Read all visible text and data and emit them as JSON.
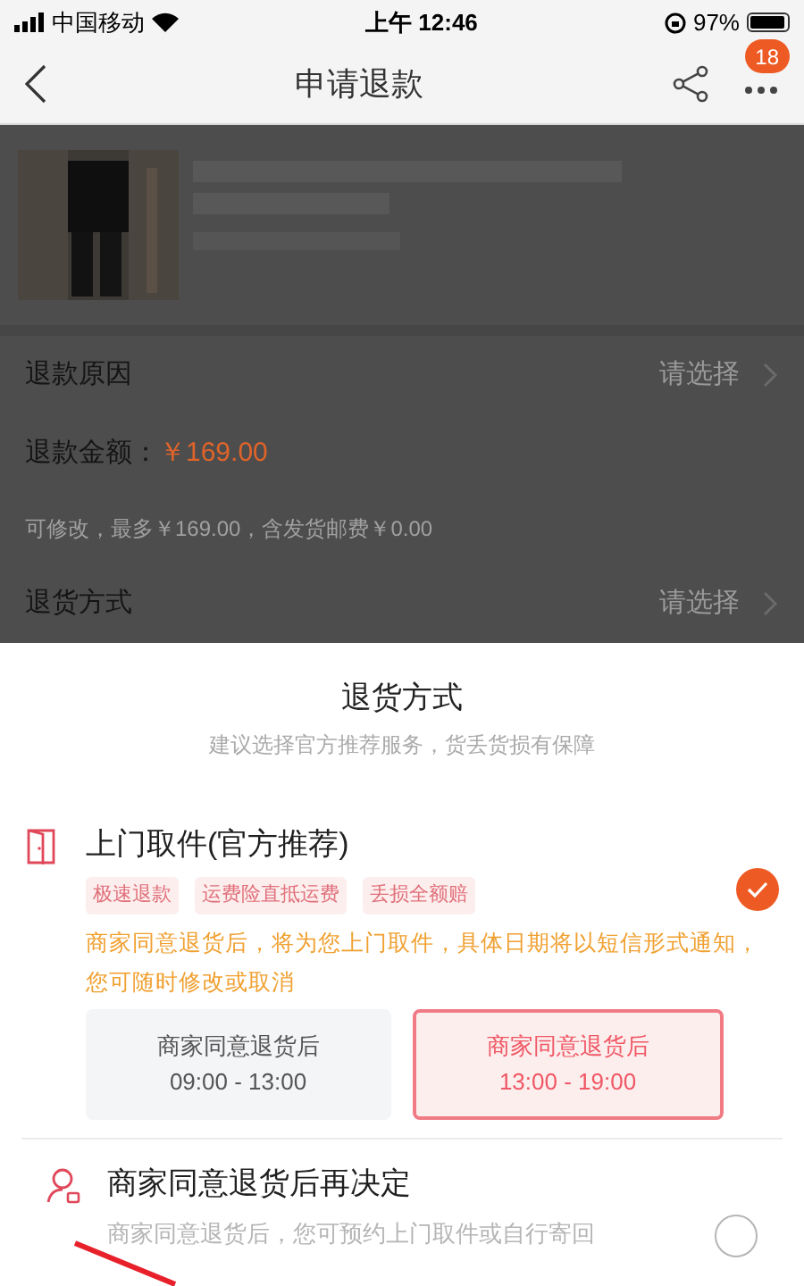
{
  "status_bar": {
    "carrier": "中国移动",
    "time": "上午 12:46",
    "battery": "97%"
  },
  "nav": {
    "title": "申请退款",
    "badge": "18"
  },
  "form": [
    {
      "kind": "select",
      "label": "退款原因",
      "value": "请选择"
    },
    {
      "kind": "amount",
      "label": "退款金额：",
      "amount": "￥169.00"
    },
    {
      "kind": "note",
      "text": "可修改，最多￥169.00，含发货邮费￥0.00"
    },
    {
      "kind": "select",
      "label": "退货方式",
      "value": "请选择"
    }
  ],
  "sheet": {
    "title": "退货方式",
    "subtitle": "建议选择官方推荐服务，货丢货损有保障",
    "options": [
      {
        "kind": "pickup",
        "title": "上门取件(官方推荐)",
        "selected": true,
        "tags": [
          "极速退款",
          "运费险直抵运费",
          "丢损全额赔"
        ],
        "note": "商家同意退货后，将为您上门取件，具体日期将以短信形式通知，您可随时修改或取消",
        "slots": [
          {
            "line1": "商家同意退货后",
            "line2": "09:00 - 13:00",
            "selected": false
          },
          {
            "line1": "商家同意退货后",
            "line2": "13:00 - 19:00",
            "selected": true
          }
        ]
      },
      {
        "kind": "later",
        "title": "商家同意退货后再决定",
        "selected": false,
        "description": "商家同意退货后，您可预约上门取件或自行寄回"
      }
    ]
  }
}
